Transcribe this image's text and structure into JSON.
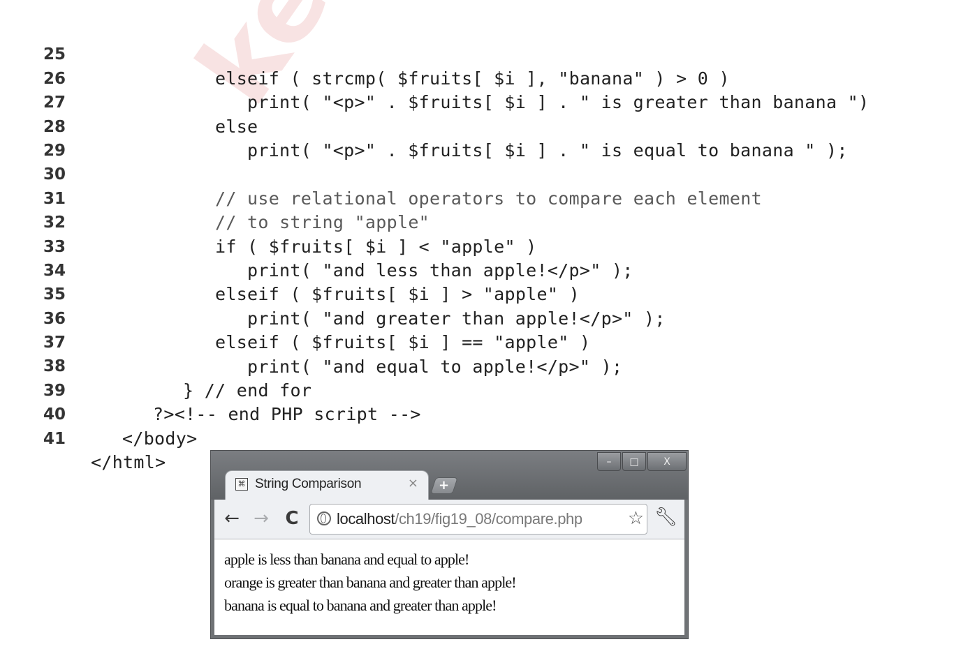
{
  "watermark": "keralanotes",
  "code_lines": [
    {
      "num": "25",
      "code": "elseif ( strcmp( $fruits[ $i ], \"banana\" ) > 0 )"
    },
    {
      "num": "26",
      "code": "print( \"<p>\" . $fruits[ $i ] . \" is greater than banana \")"
    },
    {
      "num": "27",
      "code": "else"
    },
    {
      "num": "28",
      "code": "print( \"<p>\" . $fruits[ $i ] . \" is equal to banana \" );"
    },
    {
      "num": "29",
      "code": ""
    },
    {
      "num": "30",
      "code": "// use relational operators to compare each element"
    },
    {
      "num": "31",
      "code": "// to string \"apple\""
    },
    {
      "num": "32",
      "code": "if ( $fruits[ $i ] < \"apple\" )"
    },
    {
      "num": "33",
      "code": "print( \"and less than apple!</p>\" );"
    },
    {
      "num": "34",
      "code": "elseif ( $fruits[ $i ] > \"apple\" )"
    },
    {
      "num": "35",
      "code": "print( \"and greater than apple!</p>\" );"
    },
    {
      "num": "36",
      "code": "elseif ( $fruits[ $i ] == \"apple\" )"
    },
    {
      "num": "37",
      "code": "print( \"and equal to apple!</p>\" );"
    },
    {
      "num": "38",
      "code": "} // end for"
    },
    {
      "num": "39",
      "code": "?><!-- end PHP script -->"
    },
    {
      "num": "40",
      "code": "</body>"
    },
    {
      "num": "41",
      "code": "</html>"
    }
  ],
  "browser": {
    "tab_title": "String Comparison",
    "tab_close": "×",
    "new_tab": "+",
    "window_buttons": {
      "minimize": "–",
      "maximize": "□",
      "close": "X"
    },
    "nav": {
      "back": "←",
      "forward": "→",
      "reload": "C"
    },
    "url_host": "localhost",
    "url_path": "/ch19/fig19_08/compare.php",
    "bookmark_icon": "star-icon",
    "menu_icon": "wrench-icon",
    "output_lines": [
      "apple is less than banana and equal to apple!",
      "orange is greater than banana and greater than apple!",
      "banana is equal to banana and greater than apple!"
    ]
  }
}
